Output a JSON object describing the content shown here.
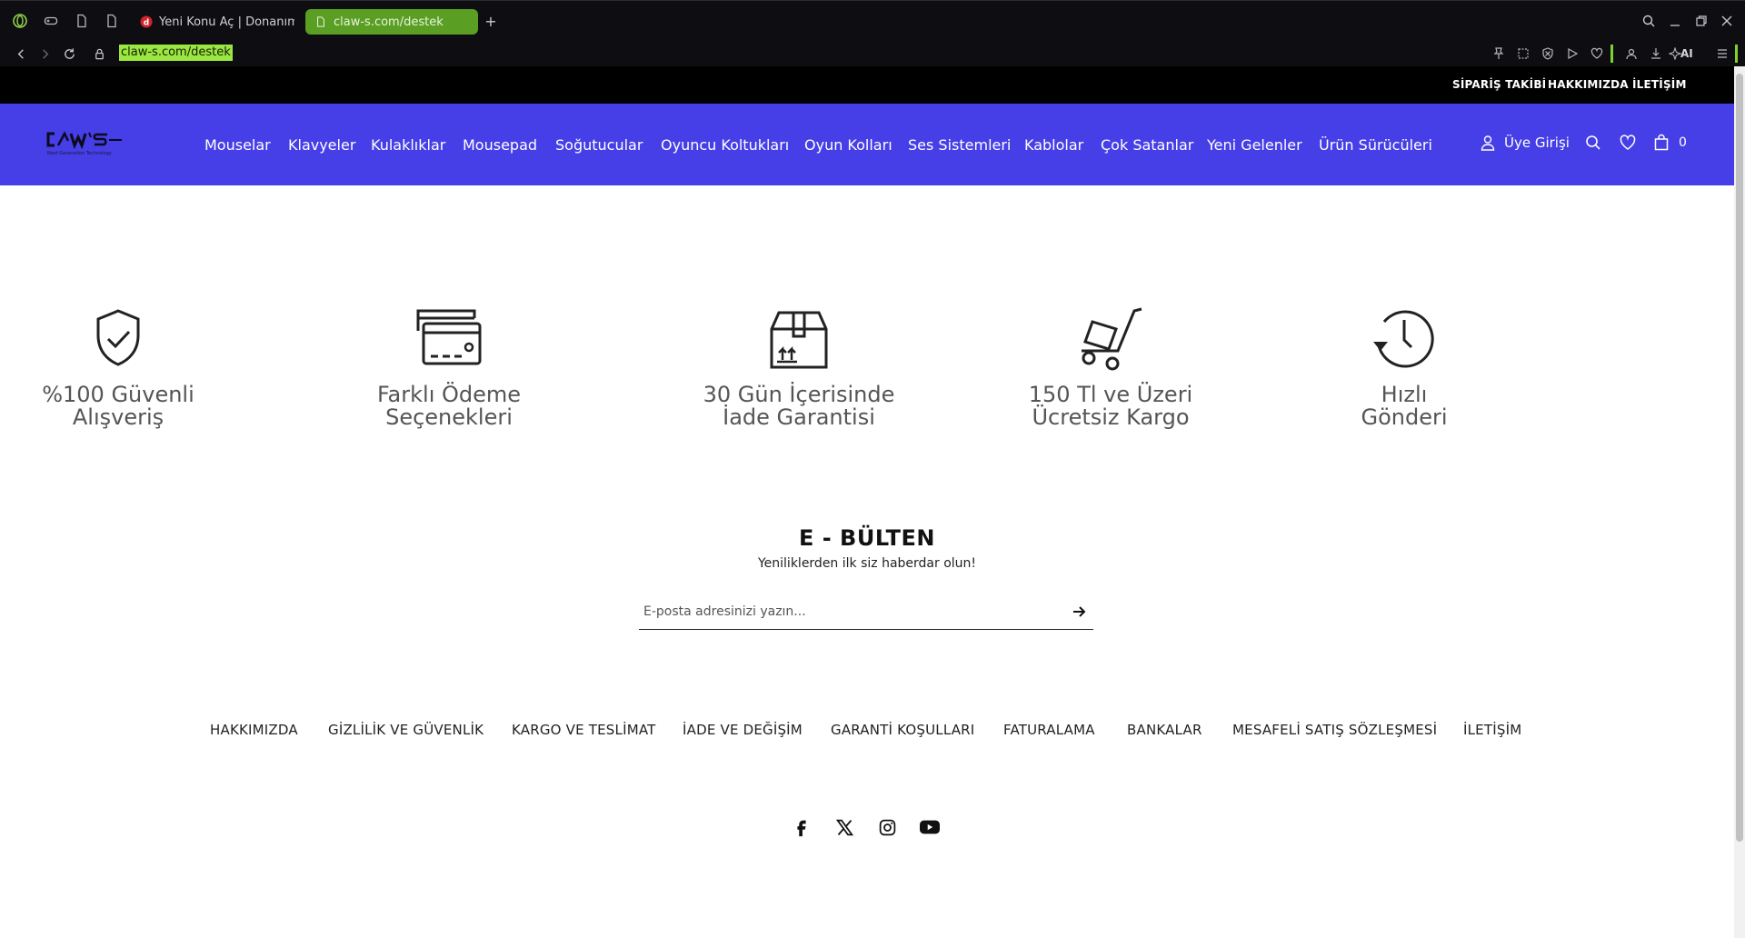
{
  "browser": {
    "tabs": [
      {
        "title": "Yeni Konu Aç | Donanım Arşivi Forum",
        "active": false
      },
      {
        "title": "claw-s.com/destek",
        "active": true
      }
    ],
    "url": "claw-s.com/destek",
    "ai_label": "AI",
    "accent_color": "#5a9f23"
  },
  "topbar": {
    "links": [
      "SİPARİŞ TAKİBİ",
      "HAKKIMIZDA",
      "İLETİŞİM"
    ]
  },
  "header": {
    "logo_text": "CLAW'S",
    "logo_tagline": "Next Generation Technology",
    "nav_color": "#463ee6",
    "menu": [
      "Mouselar",
      "Klavyeler",
      "Kulaklıklar",
      "Mousepad",
      "Soğutucular",
      "Oyuncu Koltukları",
      "Oyun Kolları",
      "Ses Sistemleri",
      "Kablolar",
      "Çok Satanlar",
      "Yeni Gelenler",
      "Ürün Sürücüleri"
    ],
    "login_label": "Üye Girişi",
    "cart_count": "0"
  },
  "features": [
    {
      "line1": "%100 Güvenli",
      "line2": "Alışveriş",
      "icon": "shield-check-icon"
    },
    {
      "line1": "Farklı Ödeme",
      "line2": "Seçenekleri",
      "icon": "credit-card-icon"
    },
    {
      "line1": "30 Gün İçerisinde",
      "line2": "İade Garantisi",
      "icon": "return-box-icon"
    },
    {
      "line1": "150 Tl ve Üzeri",
      "line2": "Ücretsiz Kargo",
      "icon": "hand-truck-icon"
    },
    {
      "line1": "Hızlı",
      "line2": "Gönderi",
      "icon": "clock-icon"
    }
  ],
  "newsletter": {
    "title": "E - BÜLTEN",
    "subtitle": "Yeniliklerden ilk siz haberdar olun!",
    "placeholder": "E-posta adresinizi yazın..."
  },
  "footer": {
    "links": [
      "HAKKIMIZDA",
      "GİZLİLİK VE GÜVENLİK",
      "KARGO VE TESLİMAT",
      "İADE VE DEĞİŞİM",
      "GARANTİ KOŞULLARI",
      "FATURALAMA",
      "BANKALAR",
      "MESAFELİ SATIŞ SÖZLEŞMESİ",
      "İLETİŞİM"
    ],
    "social": [
      "facebook-icon",
      "x-icon",
      "instagram-icon",
      "youtube-icon"
    ]
  }
}
